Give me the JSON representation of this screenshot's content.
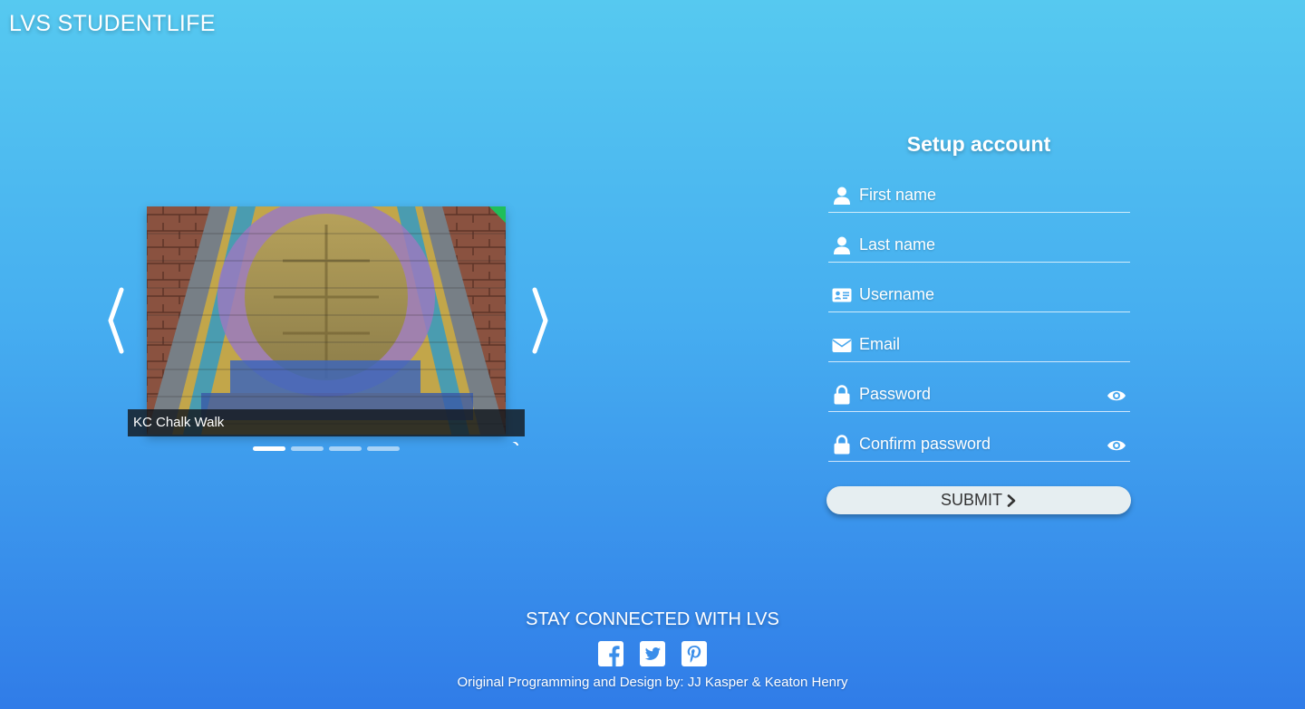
{
  "header": {
    "brand": "LVS STUDENTLIFE"
  },
  "carousel": {
    "caption": "KC Chalk Walk",
    "indicators": 4,
    "active_index": 0,
    "prev_icon": "chevron-left-icon",
    "next_icon": "chevron-right-icon"
  },
  "form": {
    "title": "Setup account",
    "fields": [
      {
        "placeholder": "First name",
        "icon": "user-icon"
      },
      {
        "placeholder": "Last name",
        "icon": "user-icon"
      },
      {
        "placeholder": "Username",
        "icon": "id-card-icon"
      },
      {
        "placeholder": "Email",
        "icon": "envelope-icon"
      },
      {
        "placeholder": "Password",
        "icon": "lock-icon",
        "toggle": "eye-icon"
      },
      {
        "placeholder": "Confirm password",
        "icon": "lock-icon",
        "toggle": "eye-icon"
      }
    ],
    "submit_label": "SUBMIT"
  },
  "footer": {
    "title": "STAY CONNECTED WITH LVS",
    "social": [
      "facebook-icon",
      "twitter-icon",
      "pinterest-icon"
    ],
    "credits": "Original Programming and Design by: JJ Kasper & Keaton Henry"
  },
  "colors": {
    "background_top": "#56c9f0",
    "background_bottom": "#307ce8",
    "submit_bg": "#e6eef1",
    "caption_bg": "#14181e"
  }
}
